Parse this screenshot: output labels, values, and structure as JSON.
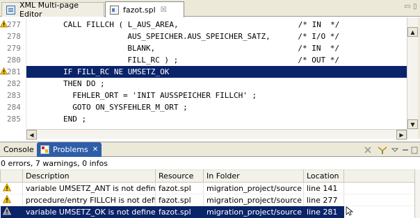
{
  "editor_tabs": [
    {
      "label": "XML Multi-page Editor",
      "icon": "xml-editor-icon",
      "active": false
    },
    {
      "label": "fazot.spl",
      "icon": "spl-file-icon",
      "active": true,
      "close": "☒"
    }
  ],
  "editor_window_controls": {
    "minimize": "▭",
    "maximize": "▯"
  },
  "code_lines": [
    {
      "num": "277",
      "text": "CALL FILLCH ( L_AUS_AREA,                          /* IN  */",
      "warning": true,
      "selected": false
    },
    {
      "num": "278",
      "text": "              AUS_SPEICHER.AUS_SPEICHER_SATZ,      /* I/O */",
      "warning": false,
      "selected": false
    },
    {
      "num": "279",
      "text": "              BLANK,                               /* IN  */",
      "warning": false,
      "selected": false
    },
    {
      "num": "280",
      "text": "              FILL_RC ) ;                          /* OUT */",
      "warning": false,
      "selected": false
    },
    {
      "num": "281",
      "text": "IF FILL_RC NE UMSETZ_OK",
      "warning": true,
      "selected": true
    },
    {
      "num": "282",
      "text": "THEN DO ;",
      "warning": false,
      "selected": false
    },
    {
      "num": "283",
      "text": "  FEHLER_ORT = 'INIT AUSSPEICHER FILLCH' ;",
      "warning": false,
      "selected": false
    },
    {
      "num": "284",
      "text": "  GOTO ON_SYSFEHLER_M_ORT ;",
      "warning": false,
      "selected": false
    },
    {
      "num": "285",
      "text": "END ;",
      "warning": false,
      "selected": false
    }
  ],
  "view_tabs": {
    "console": "Console",
    "problems": "Problems",
    "problems_close": "✕"
  },
  "summary": "0 errors, 7 warnings, 0 infos",
  "table": {
    "headers": [
      "",
      "Description",
      "Resource",
      "In Folder",
      "Location"
    ],
    "rows": [
      {
        "description": "variable UMSETZ_ANT is not defined",
        "resource": "fazot.spl",
        "folder": "migration_project/source",
        "location": "line 141",
        "selected": false
      },
      {
        "description": "procedure/entry FILLCH is not defi...",
        "resource": "fazot.spl",
        "folder": "migration_project/source",
        "location": "line 277",
        "selected": false
      },
      {
        "description": "variable UMSETZ_OK is not defined",
        "resource": "fazot.spl",
        "folder": "migration_project/source",
        "location": "line 281",
        "selected": true
      }
    ]
  },
  "colors": {
    "selection": "#0a246a",
    "active_view_tab": "#2f5ea8",
    "warning": "#f0c000",
    "chrome": "#ece9d8"
  }
}
